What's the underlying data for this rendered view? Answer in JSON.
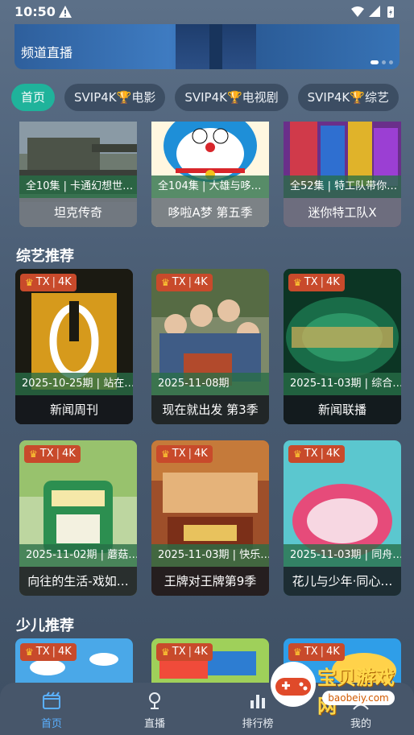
{
  "status_bar": {
    "time": "10:50"
  },
  "banner": {
    "caption": "频道直播"
  },
  "tabs": [
    {
      "label": "首页",
      "active": true
    },
    {
      "label": "SVIP4K🏆电影"
    },
    {
      "label": "SVIP4K🏆电视剧"
    },
    {
      "label": "SVIP4K🏆综艺"
    }
  ],
  "top_row": [
    {
      "info": "全10集 | 卡通幻想世…",
      "title": "坦克传奇"
    },
    {
      "info": "全104集 | 大雄与哆…",
      "title": "哆啦A梦 第五季"
    },
    {
      "info": "全52集 | 特工队带你…",
      "title": "迷你特工队X"
    }
  ],
  "variety": {
    "title": "综艺推荐",
    "cards": [
      {
        "badge_tag": "TX",
        "badge_quality": "4K",
        "info": "2025-10-25期 | 站在…",
        "title": "新闻周刊"
      },
      {
        "badge_tag": "TX",
        "badge_quality": "4K",
        "info": "2025-11-08期",
        "title": "现在就出发 第3季"
      },
      {
        "badge_tag": "TX",
        "badge_quality": "4K",
        "info": "2025-11-03期 | 综合…",
        "title": "新闻联播"
      },
      {
        "badge_tag": "TX",
        "badge_quality": "4K",
        "info": "2025-11-02期 | 蘑菇…",
        "title": "向往的生活-戏如…"
      },
      {
        "badge_tag": "TX",
        "badge_quality": "4K",
        "info": "2025-11-03期 | 快乐…",
        "title": "王牌对王牌第9季"
      },
      {
        "badge_tag": "TX",
        "badge_quality": "4K",
        "info": "2025-11-03期 | 同舟…",
        "title": "花儿与少年·同心…"
      }
    ]
  },
  "kids": {
    "title": "少儿推荐",
    "cards": [
      {
        "badge_tag": "TX",
        "badge_quality": "4K"
      },
      {
        "badge_tag": "TX",
        "badge_quality": "4K"
      },
      {
        "badge_tag": "TX",
        "badge_quality": "4K"
      }
    ]
  },
  "bottom_nav": [
    {
      "label": "首页",
      "icon": "home-icon",
      "active": true
    },
    {
      "label": "直播",
      "icon": "live-icon"
    },
    {
      "label": "排行榜",
      "icon": "ranking-icon"
    },
    {
      "label": "我的",
      "icon": "profile-icon"
    }
  ],
  "watermark": {
    "text": "宝贝游戏网",
    "url": "baobeiy.com"
  },
  "colors": {
    "accent": "#1fb39b",
    "badge": "#c84a2b",
    "nav_active": "#5ab0ff"
  }
}
